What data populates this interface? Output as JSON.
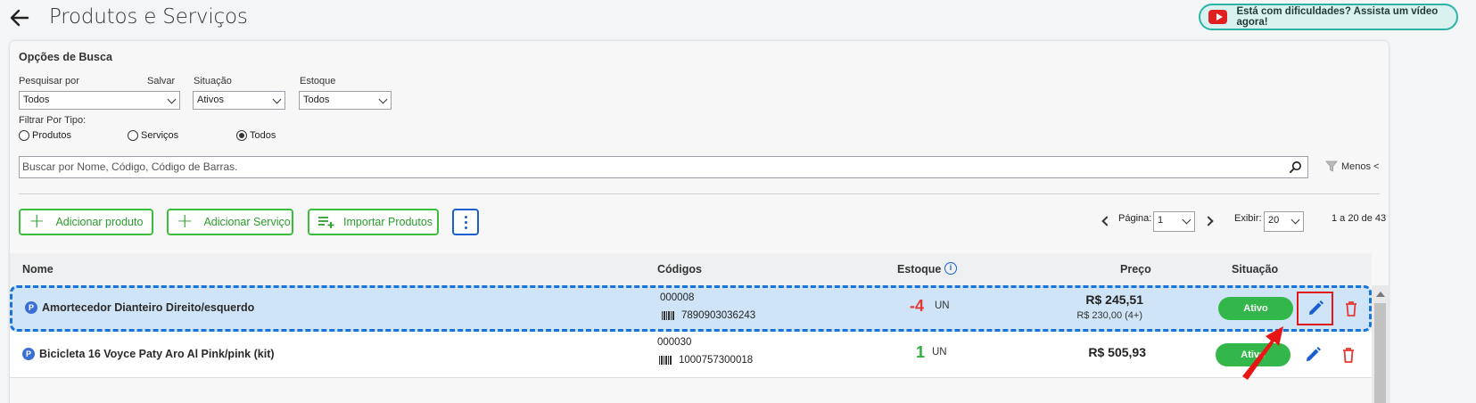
{
  "header": {
    "title": "Produtos e Serviços",
    "help_text": "Está com dificuldades? Assista um vídeo agora!"
  },
  "search": {
    "title": "Opções de Busca",
    "search_by_label": "Pesquisar por",
    "save_label": "Salvar",
    "search_by_value": "Todos",
    "situation_label": "Situação",
    "situation_value": "Ativos",
    "stock_label": "Estoque",
    "stock_value": "Todos",
    "type_filter_label": "Filtrar Por Tipo:",
    "type_options": [
      "Produtos",
      "Serviços",
      "Todos"
    ],
    "type_selected": "Todos",
    "placeholder": "Buscar por Nome, Código, Código de Barras.",
    "less_label": "Menos <"
  },
  "actions": {
    "add_product": "Adicionar produto",
    "add_service": "Adicionar Serviço",
    "import_products": "Importar Produtos"
  },
  "pagination": {
    "page_label": "Página:",
    "page_value": "1",
    "show_label": "Exibir:",
    "show_value": "20",
    "range": "1 a 20 de 43"
  },
  "table": {
    "headers": {
      "name": "Nome",
      "codes": "Códigos",
      "stock": "Estoque",
      "price": "Preço",
      "status": "Situação"
    },
    "rows": [
      {
        "badge": "P",
        "name": "Amortecedor Dianteiro Direito/esquerdo",
        "code": "000008",
        "barcode": "7890903036243",
        "stock": "-4",
        "unit": "UN",
        "price": "R$ 245,51",
        "price_secondary": "R$ 230,00 (4+)",
        "status": "Ativo"
      },
      {
        "badge": "P",
        "name": "Bicicleta 16 Voyce Paty Aro Al Pink/pink (kit)",
        "code": "000030",
        "barcode": "1000757300018",
        "stock": "1",
        "unit": "UN",
        "price": "R$ 505,93",
        "price_secondary": "",
        "status": "Ativo"
      }
    ]
  },
  "colors": {
    "accent_green": "#33b64a",
    "accent_blue": "#1a5fd0",
    "negative_red": "#e53935",
    "positive_green": "#2fae3f"
  }
}
